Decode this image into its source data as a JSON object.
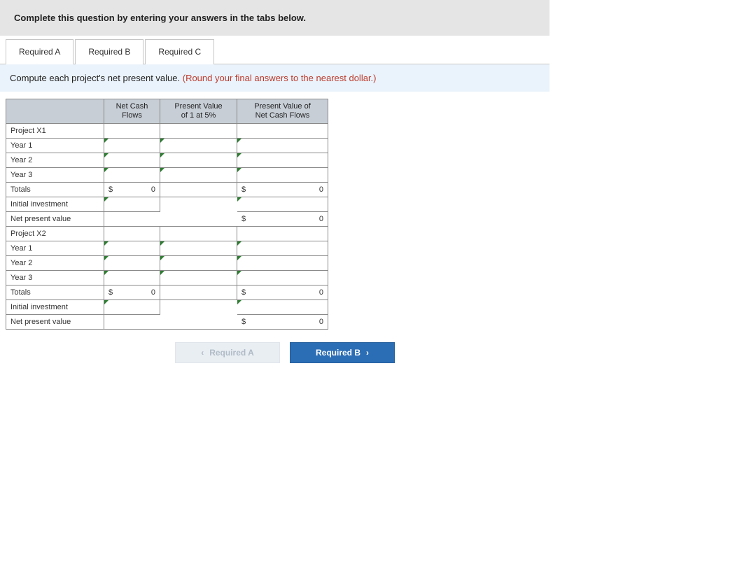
{
  "instruction": "Complete this question by entering your answers in the tabs below.",
  "tabs": {
    "a": "Required A",
    "b": "Required B",
    "c": "Required C"
  },
  "prompt": {
    "text": "Compute each project's net present value. ",
    "hint": "(Round your final answers to the nearest dollar.)"
  },
  "headers": {
    "ncf_l1": "Net Cash",
    "ncf_l2": "Flows",
    "pvf_l1": "Present Value",
    "pvf_l2": "of 1 at 5%",
    "pvncf_l1": "Present Value of",
    "pvncf_l2": "Net Cash Flows"
  },
  "rows": {
    "p1": "Project X1",
    "y1": "Year 1",
    "y2": "Year 2",
    "y3": "Year 3",
    "totals": "Totals",
    "init": "Initial investment",
    "npv": "Net present value",
    "p2": "Project X2"
  },
  "currency": "$",
  "zero": "0",
  "nav": {
    "prev": "Required A",
    "next": "Required B"
  },
  "chart_data": {
    "type": "table",
    "title": "Net Present Value Computation",
    "columns": [
      "",
      "Net Cash Flows",
      "Present Value of 1 at 5%",
      "Present Value of Net Cash Flows"
    ],
    "rows": [
      {
        "label": "Project X1",
        "ncf": null,
        "pvf": null,
        "pvncf": null
      },
      {
        "label": "Year 1",
        "ncf": null,
        "pvf": null,
        "pvncf": null
      },
      {
        "label": "Year 2",
        "ncf": null,
        "pvf": null,
        "pvncf": null
      },
      {
        "label": "Year 3",
        "ncf": null,
        "pvf": null,
        "pvncf": null
      },
      {
        "label": "Totals",
        "ncf": 0,
        "pvf": null,
        "pvncf": 0
      },
      {
        "label": "Initial investment",
        "ncf": null,
        "pvf": null,
        "pvncf": null
      },
      {
        "label": "Net present value",
        "ncf": null,
        "pvf": null,
        "pvncf": 0
      },
      {
        "label": "Project X2",
        "ncf": null,
        "pvf": null,
        "pvncf": null
      },
      {
        "label": "Year 1",
        "ncf": null,
        "pvf": null,
        "pvncf": null
      },
      {
        "label": "Year 2",
        "ncf": null,
        "pvf": null,
        "pvncf": null
      },
      {
        "label": "Year 3",
        "ncf": null,
        "pvf": null,
        "pvncf": null
      },
      {
        "label": "Totals",
        "ncf": 0,
        "pvf": null,
        "pvncf": 0
      },
      {
        "label": "Initial investment",
        "ncf": null,
        "pvf": null,
        "pvncf": null
      },
      {
        "label": "Net present value",
        "ncf": null,
        "pvf": null,
        "pvncf": 0
      }
    ]
  }
}
